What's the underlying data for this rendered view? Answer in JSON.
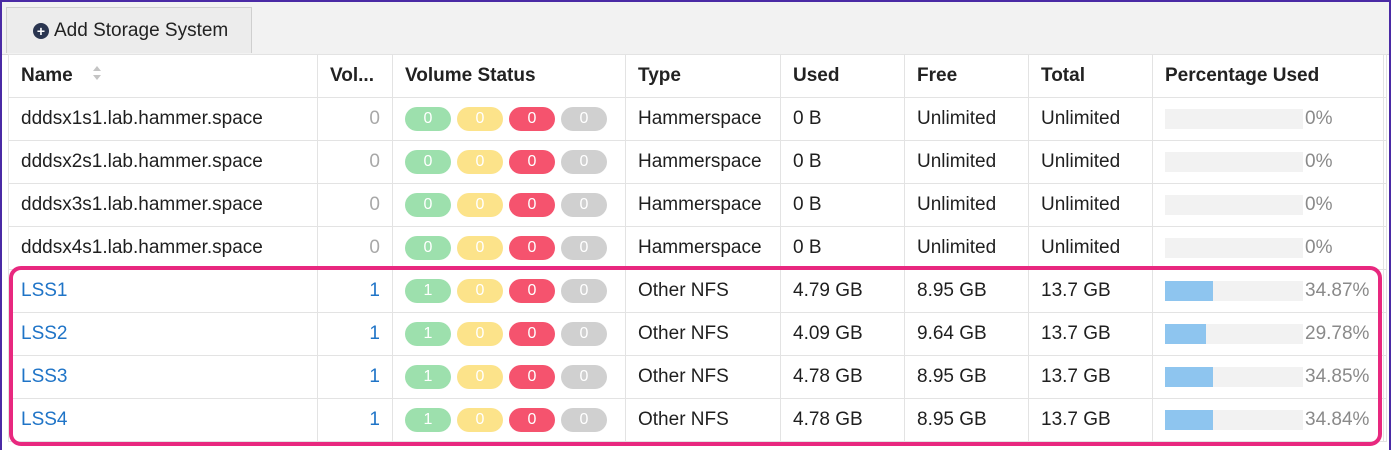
{
  "toolbar": {
    "add_label": "Add Storage System"
  },
  "columns": {
    "name": "Name",
    "volumes": "Vol...",
    "status": "Volume Status",
    "type": "Type",
    "used": "Used",
    "free": "Free",
    "total": "Total",
    "pct": "Percentage Used"
  },
  "rows": [
    {
      "name": "dddsx1s1.lab.hammer.space",
      "volumes": "0",
      "status": [
        "0",
        "0",
        "0",
        "0"
      ],
      "type": "Hammerspace",
      "used": "0 B",
      "free": "Unlimited",
      "total": "Unlimited",
      "pct_text": "0%",
      "pct": 0
    },
    {
      "name": "dddsx2s1.lab.hammer.space",
      "volumes": "0",
      "status": [
        "0",
        "0",
        "0",
        "0"
      ],
      "type": "Hammerspace",
      "used": "0 B",
      "free": "Unlimited",
      "total": "Unlimited",
      "pct_text": "0%",
      "pct": 0
    },
    {
      "name": "dddsx3s1.lab.hammer.space",
      "volumes": "0",
      "status": [
        "0",
        "0",
        "0",
        "0"
      ],
      "type": "Hammerspace",
      "used": "0 B",
      "free": "Unlimited",
      "total": "Unlimited",
      "pct_text": "0%",
      "pct": 0
    },
    {
      "name": "dddsx4s1.lab.hammer.space",
      "volumes": "0",
      "status": [
        "0",
        "0",
        "0",
        "0"
      ],
      "type": "Hammerspace",
      "used": "0 B",
      "free": "Unlimited",
      "total": "Unlimited",
      "pct_text": "0%",
      "pct": 0
    },
    {
      "name": "LSS1",
      "volumes": "1",
      "status": [
        "1",
        "0",
        "0",
        "0"
      ],
      "type": "Other NFS",
      "used": "4.79 GB",
      "free": "8.95 GB",
      "total": "13.7 GB",
      "pct_text": "34.87%",
      "pct": 34.87
    },
    {
      "name": "LSS2",
      "volumes": "1",
      "status": [
        "1",
        "0",
        "0",
        "0"
      ],
      "type": "Other NFS",
      "used": "4.09 GB",
      "free": "9.64 GB",
      "total": "13.7 GB",
      "pct_text": "29.78%",
      "pct": 29.78
    },
    {
      "name": "LSS3",
      "volumes": "1",
      "status": [
        "1",
        "0",
        "0",
        "0"
      ],
      "type": "Other NFS",
      "used": "4.78 GB",
      "free": "8.95 GB",
      "total": "13.7 GB",
      "pct_text": "34.85%",
      "pct": 34.85
    },
    {
      "name": "LSS4",
      "volumes": "1",
      "status": [
        "1",
        "0",
        "0",
        "0"
      ],
      "type": "Other NFS",
      "used": "4.78 GB",
      "free": "8.95 GB",
      "total": "13.7 GB",
      "pct_text": "34.84%",
      "pct": 34.84
    }
  ],
  "colors": {
    "link": "#1f74c7",
    "status_green": "#9de0ad",
    "status_yellow": "#fce38a",
    "status_red": "#f5536e",
    "status_gray": "#d0d0d0",
    "bar_fill": "#8ec5ef",
    "highlight": "#e8287f"
  }
}
